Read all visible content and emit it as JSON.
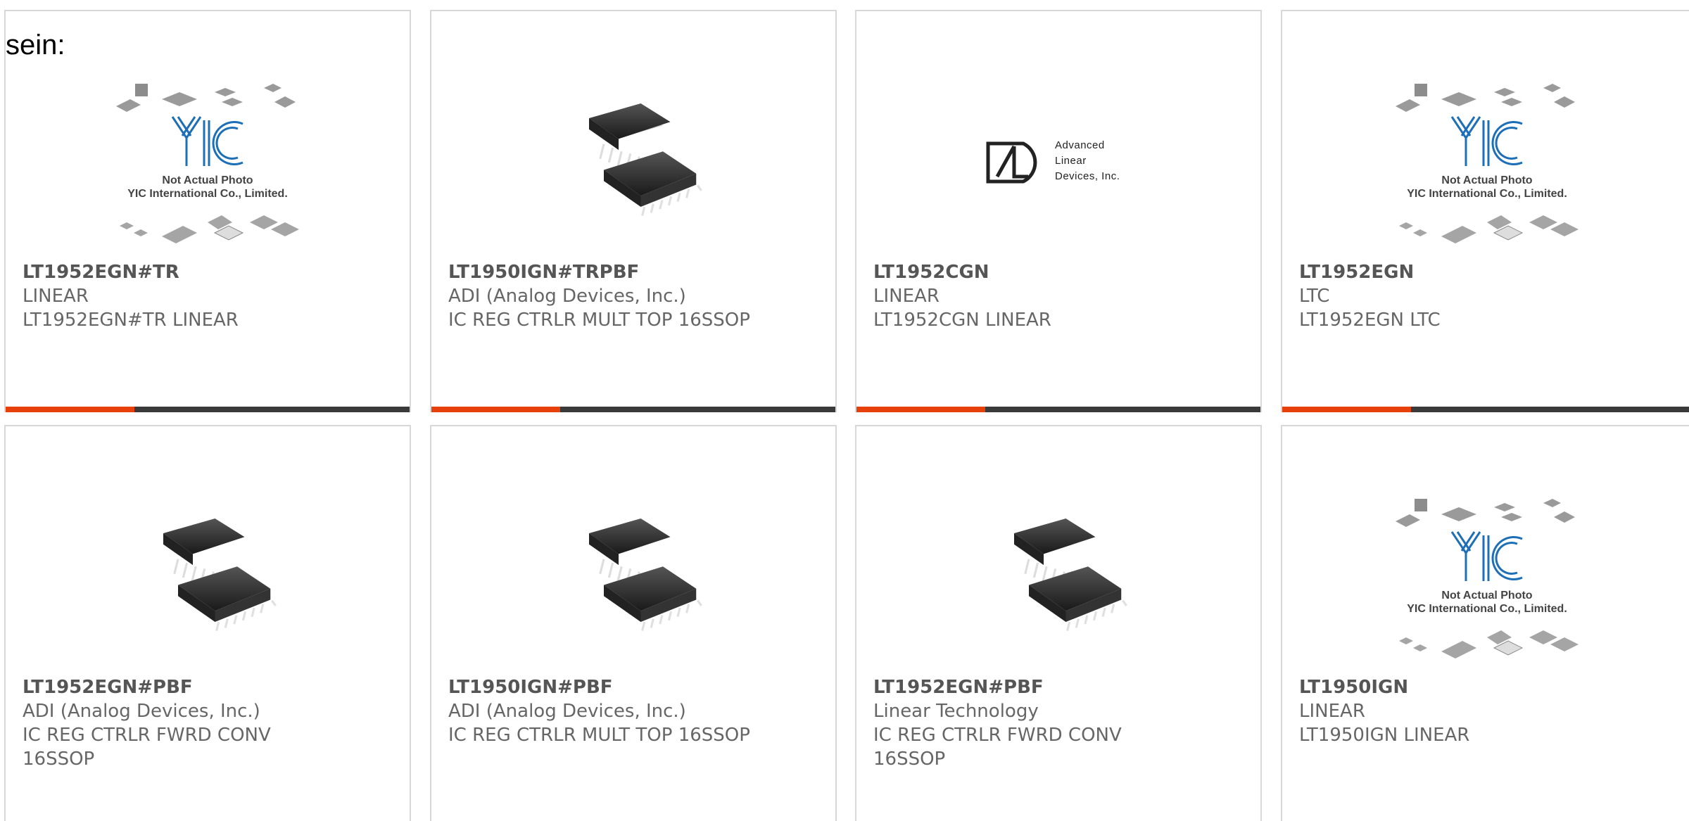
{
  "intro": {
    "text": "sein:"
  },
  "placeholder": {
    "line1": "Not Actual Photo",
    "line2": "YIC International Co., Limited."
  },
  "ald_logo": {
    "line1": "Advanced",
    "line2": "Linear",
    "line3": "Devices, Inc."
  },
  "colors": {
    "accent": "#e8400a",
    "bar_dark": "#3a3a3a",
    "border": "#d8d8d8",
    "text": "#666666"
  },
  "products": [
    {
      "part": "LT1952EGN#TR",
      "manufacturer": "LINEAR",
      "desc1": "LT1952EGN#TR LINEAR",
      "desc2": "",
      "image": "not-actual-photo-icon"
    },
    {
      "part": "LT1950IGN#TRPBF",
      "manufacturer": "ADI (Analog Devices, Inc.)",
      "desc1": "IC REG CTRLR MULT TOP 16SSOP",
      "desc2": "",
      "image": "ssop-chip-icon"
    },
    {
      "part": "LT1952CGN",
      "manufacturer": "LINEAR",
      "desc1": "LT1952CGN LINEAR",
      "desc2": "",
      "image": "ald-logo-icon"
    },
    {
      "part": "LT1952EGN",
      "manufacturer": "LTC",
      "desc1": "LT1952EGN LTC",
      "desc2": "",
      "image": "not-actual-photo-icon"
    },
    {
      "part": "LT1952EGN#PBF",
      "manufacturer": "ADI (Analog Devices, Inc.)",
      "desc1": "IC REG CTRLR FWRD CONV",
      "desc2": "16SSOP",
      "image": "ssop-chip-icon"
    },
    {
      "part": "LT1950IGN#PBF",
      "manufacturer": "ADI (Analog Devices, Inc.)",
      "desc1": "IC REG CTRLR MULT TOP 16SSOP",
      "desc2": "",
      "image": "ssop-chip-icon"
    },
    {
      "part": "LT1952EGN#PBF",
      "manufacturer": "Linear Technology",
      "desc1": "IC REG CTRLR FWRD CONV",
      "desc2": "16SSOP",
      "image": "ssop-chip-icon"
    },
    {
      "part": "LT1950IGN",
      "manufacturer": "LINEAR",
      "desc1": "LT1950IGN LINEAR",
      "desc2": "",
      "image": "not-actual-photo-icon"
    }
  ]
}
